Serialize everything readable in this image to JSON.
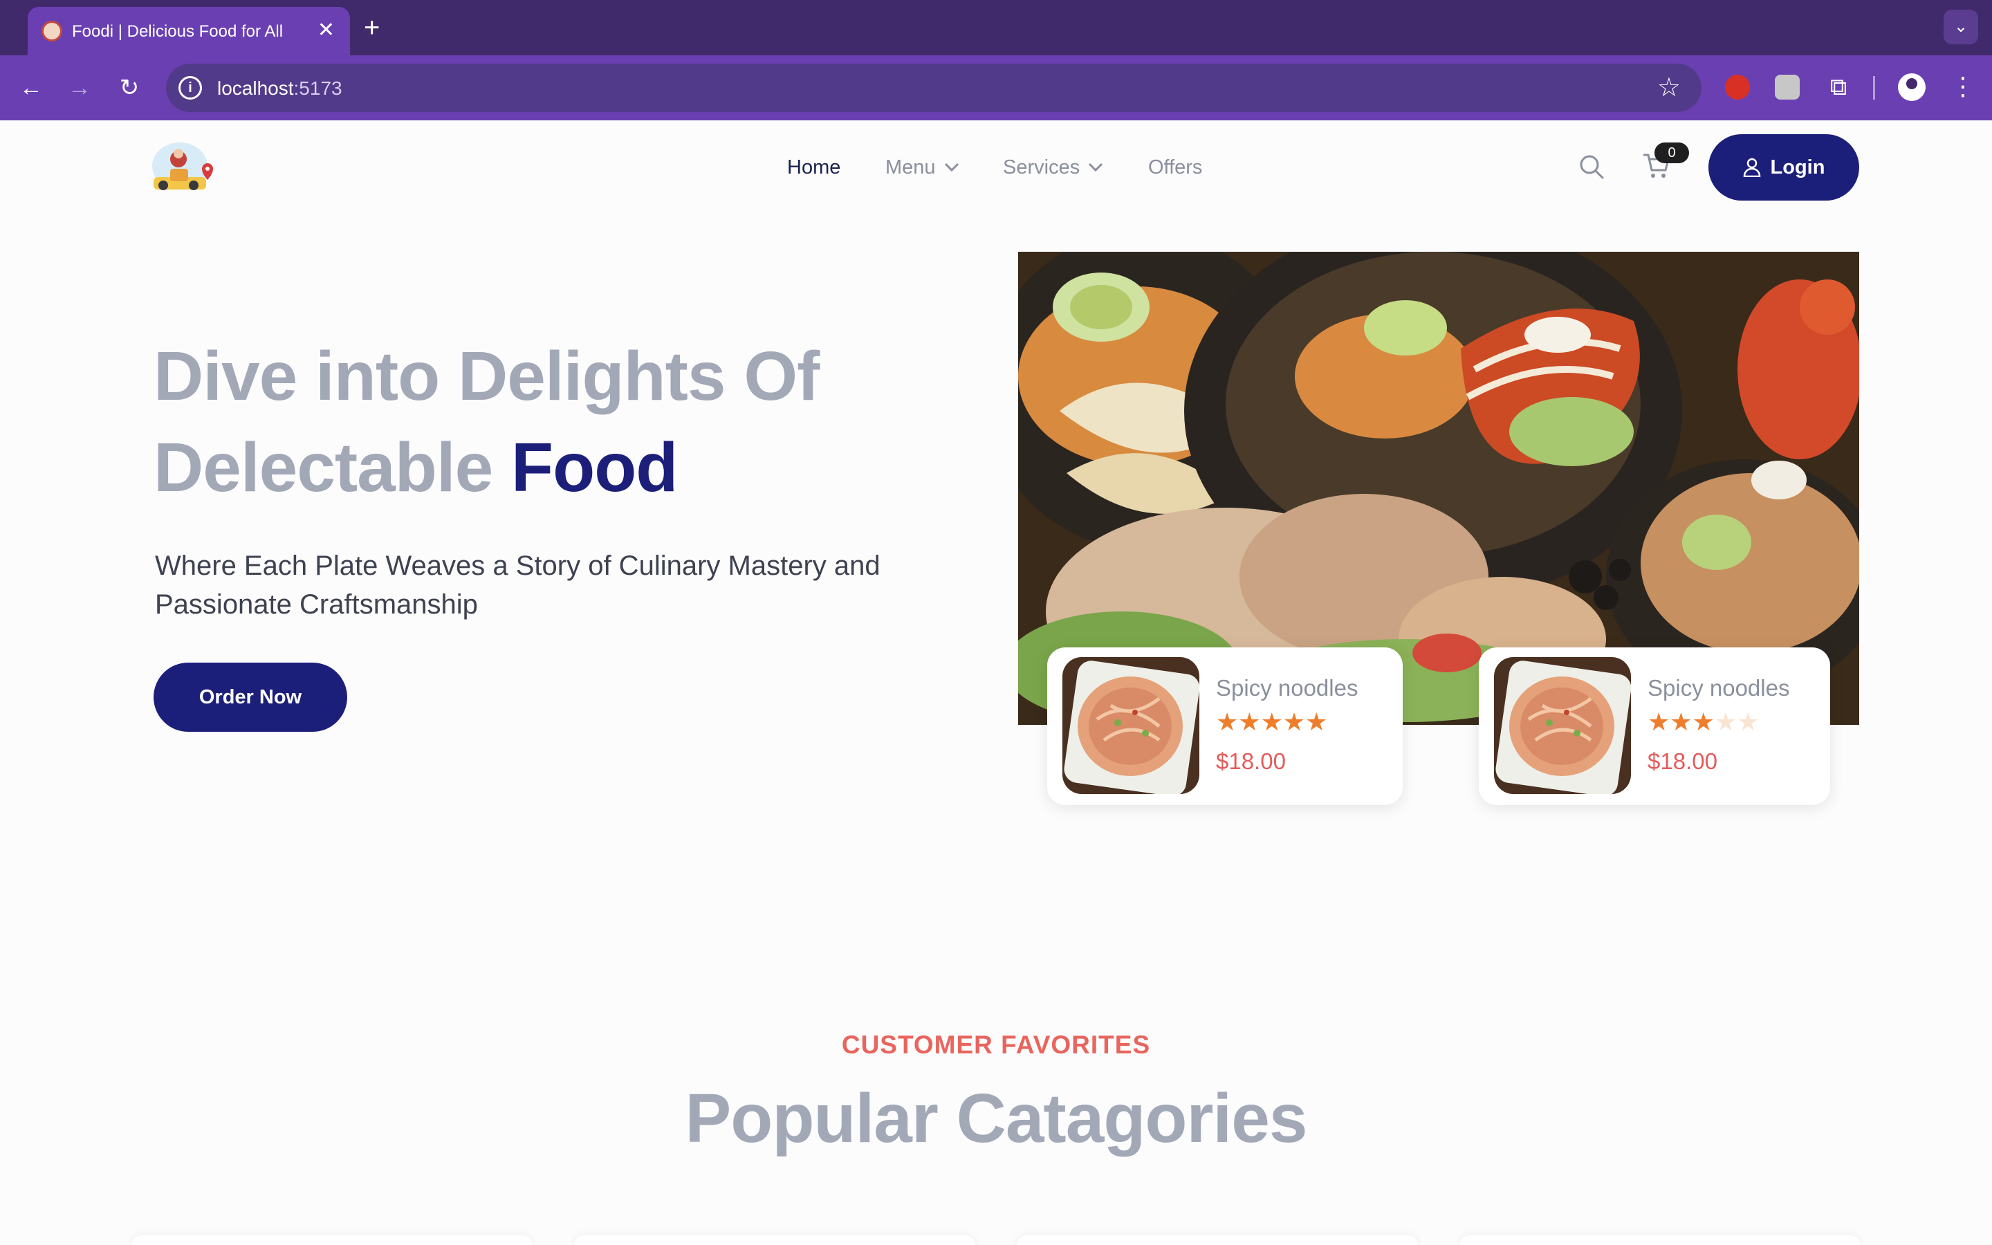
{
  "browser": {
    "tab_title": "Foodi | Delicious Food for All",
    "tab_close": "✕",
    "new_tab": "+",
    "tabs_menu": "⌄",
    "url_host": "localhost",
    "url_port": ":5173",
    "back": "←",
    "forward": "→",
    "reload": "↻",
    "info": "i",
    "star": "☆",
    "extensions": "⧉",
    "menu": "⋮"
  },
  "nav": {
    "home": "Home",
    "menu": "Menu",
    "services": "Services",
    "offers": "Offers",
    "dropdown_glyph": "⌄",
    "cart_count": "0",
    "login": "Login"
  },
  "hero": {
    "title_line1": "Dive into Delights Of",
    "title_line2": "Delectable",
    "title_accent": "Food",
    "subtitle": "Where Each Plate Weaves a Story of Culinary Mastery and Passionate Craftsmanship",
    "cta": "Order Now"
  },
  "cards": [
    {
      "name": "Spicy noodles",
      "rating": 5,
      "price": "$18.00"
    },
    {
      "name": "Spicy noodles",
      "rating": 3,
      "price": "$18.00"
    }
  ],
  "section": {
    "tag": "CUSTOMER FAVORITES",
    "title": "Popular Catagories"
  },
  "colors": {
    "chrome_dark": "#412a6b",
    "chrome": "#6a3fb2",
    "brand_navy": "#1c1f7a",
    "muted_heading": "#a3a8b7",
    "accent_red": "#e8655d",
    "star_orange": "#ee7d2c"
  },
  "icons": [
    "back-arrow-icon",
    "forward-arrow-icon",
    "reload-icon",
    "info-icon",
    "star-icon",
    "extension-icon",
    "profile-icon",
    "kebab-icon",
    "search-icon",
    "cart-icon",
    "user-icon",
    "chevron-down-icon"
  ]
}
